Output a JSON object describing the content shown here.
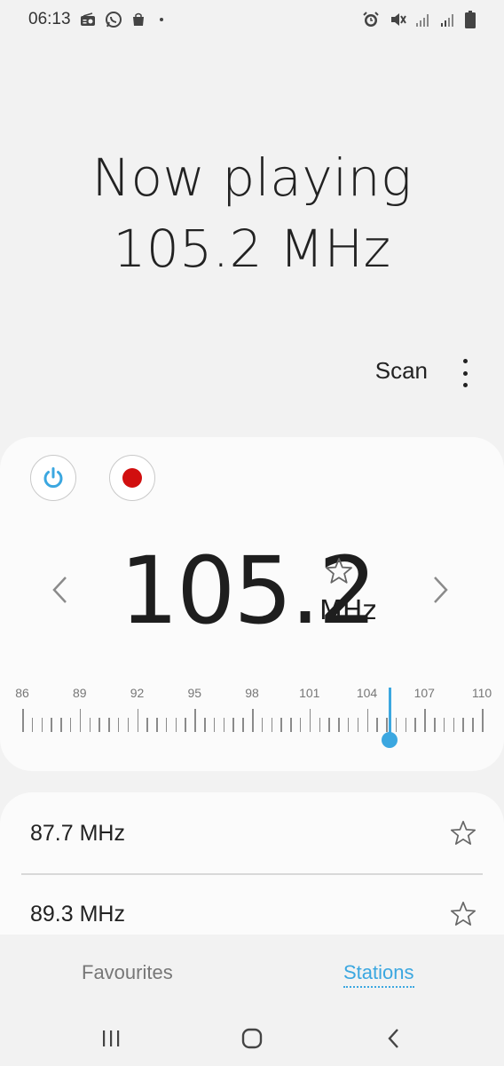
{
  "status_bar": {
    "time": "06:13",
    "left_icons": [
      "radio-icon",
      "whatsapp-icon",
      "bag-icon"
    ],
    "right_icons": [
      "alarm-icon",
      "mute-icon",
      "signal-icon",
      "signal-icon",
      "battery-icon"
    ]
  },
  "now_playing": {
    "line1": "Now playing",
    "line2": "105.2 MHz"
  },
  "toolbar": {
    "scan_label": "Scan",
    "more_icon": "more-vertical-icon"
  },
  "tuner": {
    "frequency": "105.2",
    "unit": "MHz",
    "power_color": "#3ba7e0",
    "record_color": "#d10f0f",
    "favourite": false,
    "dial_labels": [
      "86",
      "89",
      "92",
      "95",
      "98",
      "101",
      "104",
      "107",
      "110"
    ],
    "dial_min": 86,
    "dial_max": 110,
    "needle_value": 105.2
  },
  "stations": [
    {
      "freq": "87.7 MHz",
      "favourite": false
    },
    {
      "freq": "89.3 MHz",
      "favourite": false
    }
  ],
  "tabs": {
    "favourites": "Favourites",
    "stations": "Stations",
    "active": "Stations",
    "accent": "#3ba7e0"
  },
  "navbar": {
    "icons": [
      "recent-apps-icon",
      "home-icon",
      "back-icon"
    ]
  }
}
